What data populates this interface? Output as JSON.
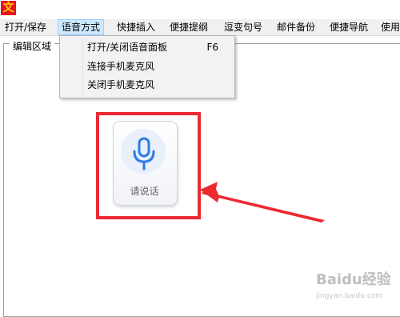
{
  "app": {
    "icon_glyph": "文",
    "icon_bg": "#e8141d",
    "icon_fg": "#ffd400"
  },
  "menubar": {
    "items": [
      {
        "label": "打开/保存"
      },
      {
        "label": "语音方式"
      },
      {
        "label": "快捷插入"
      },
      {
        "label": "便捷提纲"
      },
      {
        "label": "逗变句号"
      },
      {
        "label": "邮件备份"
      },
      {
        "label": "便捷导航"
      },
      {
        "label": "使用"
      }
    ],
    "active_index": 1
  },
  "dropdown": {
    "items": [
      {
        "label": "打开/关闭语音面板",
        "shortcut": "F6"
      },
      {
        "label": "连接手机麦克风"
      },
      {
        "label": "关闭手机麦克风"
      }
    ]
  },
  "editor": {
    "title": "编辑区域"
  },
  "voice_panel": {
    "label": "请说话",
    "icon": "microphone-icon",
    "accent": "#2c7be5"
  },
  "annotation": {
    "color": "#ec2a32"
  },
  "watermark": {
    "text": "Baidu经验",
    "sub": "jingyan.baidu.com"
  }
}
